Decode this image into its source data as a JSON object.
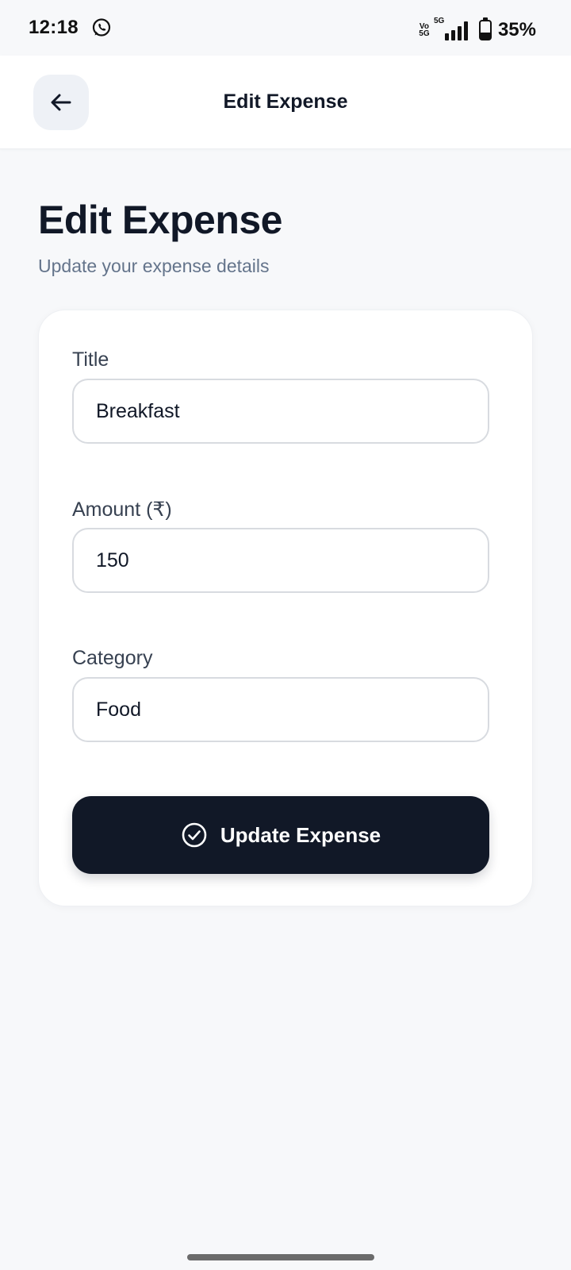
{
  "status_bar": {
    "time": "12:18",
    "notification_icon": "whatsapp-icon",
    "volte_label": "Vo\n5G",
    "network_label": "5G",
    "battery_percent_text": "35%",
    "battery_level": 0.35
  },
  "app_bar": {
    "back_icon": "arrow-left-icon",
    "title": "Edit Expense"
  },
  "header": {
    "title": "Edit Expense",
    "subtitle": "Update your expense details"
  },
  "form": {
    "title_label": "Title",
    "title_value": "Breakfast",
    "amount_label": "Amount (₹)",
    "amount_value": "150",
    "category_label": "Category",
    "category_value": "Food",
    "submit_icon": "check-circle-icon",
    "submit_label": "Update Expense"
  },
  "colors": {
    "background": "#f7f8fa",
    "primary": "#111827",
    "muted_text": "#64748b",
    "label_text": "#374151",
    "input_border": "#d8dbe0",
    "back_button_bg": "#eef1f6"
  }
}
